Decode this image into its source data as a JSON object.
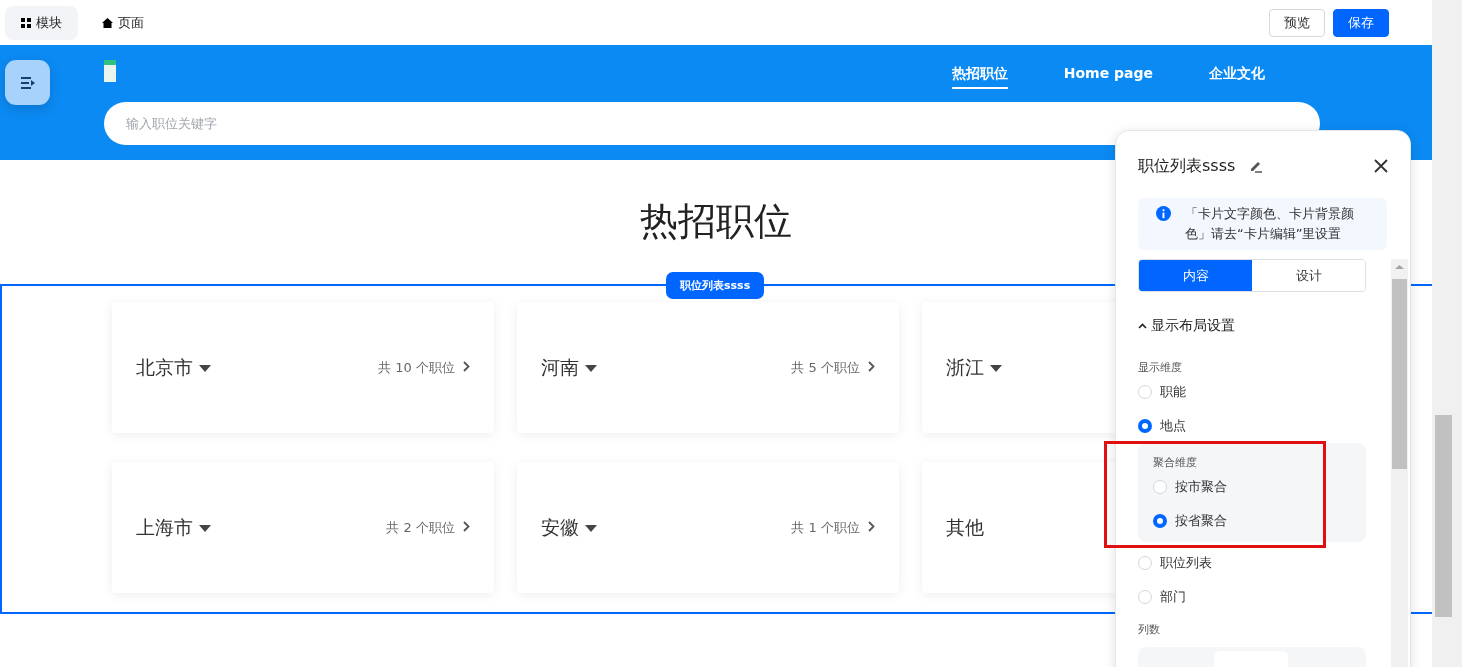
{
  "toolbar": {
    "tabs": [
      {
        "label": "模块",
        "selected": true
      },
      {
        "label": "页面",
        "selected": false
      }
    ],
    "buttons": [
      {
        "label": "预览",
        "kind": "secondary"
      },
      {
        "label": "保存",
        "kind": "primary"
      }
    ]
  },
  "header": {
    "nav": [
      {
        "label": "热招职位",
        "selected": true
      },
      {
        "label": "Home page",
        "selected": false
      },
      {
        "label": "企业文化",
        "selected": false
      }
    ],
    "search": {
      "placeholder": "输入职位关键字"
    }
  },
  "section": {
    "title": "热招职位",
    "badge": "职位列表ssss",
    "cards": [
      {
        "name": "北京市",
        "count": "共 10 个职位"
      },
      {
        "name": "河南",
        "count": "共 5 个职位"
      },
      {
        "name": "浙江"
      },
      {
        "name": "上海市",
        "count": "共 2 个职位"
      },
      {
        "name": "安徽",
        "count": "共 1 个职位"
      },
      {
        "name": "其他",
        "caret": false
      }
    ]
  },
  "panel": {
    "title": "职位列表ssss",
    "notice": "「卡片文字颜色、卡片背景颜色」请去“卡片编辑”里设置",
    "tabs": [
      {
        "label": "内容",
        "selected": true
      },
      {
        "label": "设计",
        "selected": false
      }
    ],
    "section_title": "显示布局设置",
    "expanded": true,
    "dimension": {
      "label": "显示维度",
      "options": [
        {
          "label": "职能",
          "selected": false
        },
        {
          "label": "地点",
          "selected": true,
          "sub_group": {
            "label": "聚合维度",
            "highlighted": true,
            "options": [
              {
                "label": "按市聚合",
                "selected": false
              },
              {
                "label": "按省聚合",
                "selected": true
              }
            ]
          }
        },
        {
          "label": "职位列表",
          "selected": false
        },
        {
          "label": "部门",
          "selected": false
        }
      ]
    },
    "columns_label": "列数"
  }
}
